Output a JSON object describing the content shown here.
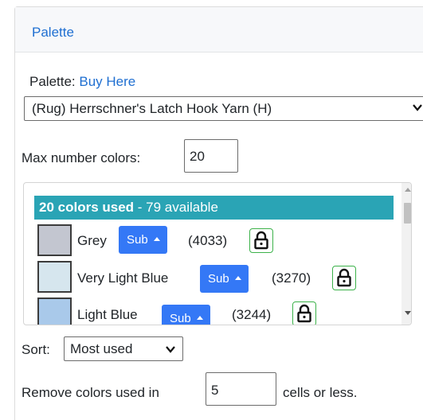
{
  "panel": {
    "title": "Palette"
  },
  "palette": {
    "label": "Palette:",
    "link_text": "Buy Here",
    "selected": "(Rug) Herrschner's Latch Hook Yarn (H)"
  },
  "max_colors": {
    "label": "Max number colors:",
    "value": "20"
  },
  "colors_list": {
    "used_text": "20 colors used",
    "available_text": " - 79 available",
    "header_color": "#2aa4b5",
    "items": [
      {
        "name": "Grey",
        "sub_label": "Sub",
        "code": "(4033)",
        "swatch": "#c3c6d0",
        "lock_icon": "lock-icon"
      },
      {
        "name": "Very Light Blue",
        "sub_label": "Sub",
        "code": "(3270)",
        "swatch": "#d6e6ee",
        "lock_icon": "lock-icon"
      },
      {
        "name": "Light Blue",
        "sub_label": "Sub",
        "code": "(3244)",
        "swatch": "#a9c9ea",
        "lock_icon": "lock-icon"
      }
    ]
  },
  "sort": {
    "label": "Sort:",
    "selected": "Most used"
  },
  "remove": {
    "label": "Remove colors used in",
    "value": "5",
    "suffix": "cells or less."
  },
  "colors": {
    "accent": "#1f6fd1",
    "button": "#3478f6",
    "lock_border": "#3cb24a"
  }
}
